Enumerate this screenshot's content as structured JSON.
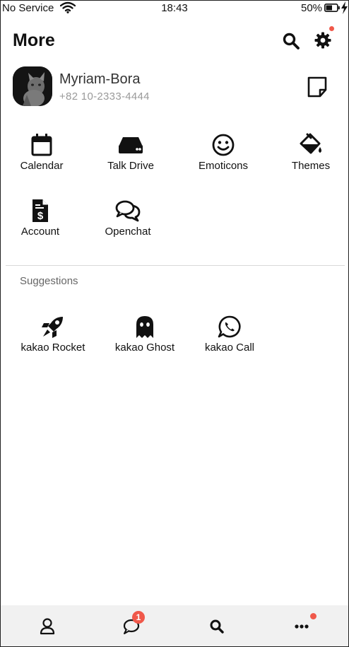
{
  "status_bar": {
    "carrier": "No Service",
    "time": "18:43",
    "battery": "50%"
  },
  "header": {
    "title": "More",
    "icons": [
      "search-icon",
      "gear-icon"
    ],
    "notification_dot_color": "#f0584a"
  },
  "profile": {
    "name": "Myriam-Bora",
    "phone": "+82 10-2333-4444"
  },
  "services": [
    {
      "label": "Calendar",
      "icon": "calendar-icon"
    },
    {
      "label": "Talk Drive",
      "icon": "drive-icon"
    },
    {
      "label": "Emoticons",
      "icon": "smiley-icon"
    },
    {
      "label": "Themes",
      "icon": "paint-bucket-icon"
    },
    {
      "label": "Account",
      "icon": "account-document-icon"
    },
    {
      "label": "Openchat",
      "icon": "chat-bubbles-icon"
    }
  ],
  "suggestions": {
    "title": "Suggestions",
    "items": [
      {
        "label": "kakao Rocket",
        "icon": "rocket-icon"
      },
      {
        "label": "kakao Ghost",
        "icon": "ghost-icon"
      },
      {
        "label": "kakao Call",
        "icon": "phone-bubble-icon"
      }
    ]
  },
  "tabbar": {
    "tabs": [
      "person-icon",
      "chat-icon",
      "search-icon",
      "more-dots-icon"
    ],
    "chat_badge": "1"
  }
}
